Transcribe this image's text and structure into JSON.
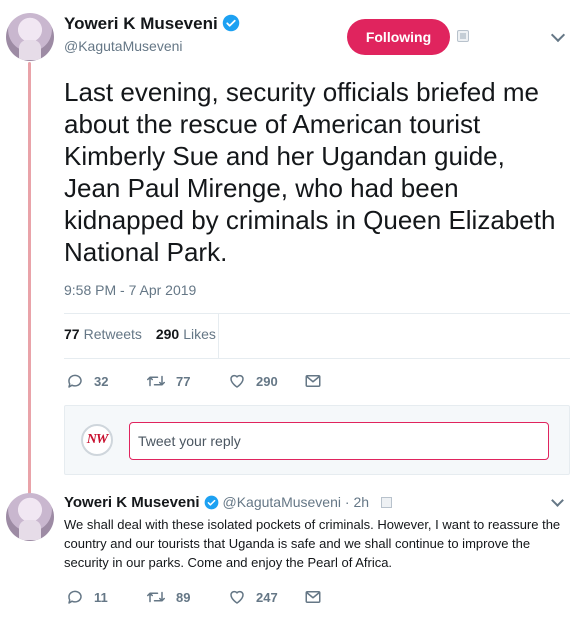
{
  "main_tweet": {
    "author_name": "Yoweri K Museveni",
    "author_handle": "@KagutaMuseveni",
    "follow_button_label": "Following",
    "text": "Last evening, security officials briefed me about the rescue of American tourist Kimberly Sue and her Ugandan guide, Jean Paul Mirenge, who had been kidnapped by criminals in Queen Elizabeth National Park.",
    "timestamp": "9:58 PM - 7 Apr 2019",
    "retweets_count": "77",
    "retweets_label": "Retweets",
    "likes_count": "290",
    "likes_label": "Likes",
    "actions": {
      "reply_count": "32",
      "retweet_count": "77",
      "like_count": "290"
    }
  },
  "reply_composer": {
    "avatar_text": "NW",
    "placeholder": "Tweet your reply"
  },
  "reply_tweet": {
    "author_name": "Yoweri K Museveni",
    "author_handle": "@KagutaMuseveni",
    "time_ago": "· 2h",
    "text": "We shall deal with these isolated pockets of criminals. However, I want to reassure the country and our tourists that Uganda is safe and we shall continue to improve the security in our parks. Come and enjoy the Pearl of Africa.",
    "actions": {
      "reply_count": "11",
      "retweet_count": "89",
      "like_count": "247"
    }
  },
  "colors": {
    "accent": "#e0245e",
    "verified": "#1da1f2",
    "secondary_text": "#657786",
    "thread_line": "#e9a3a9"
  },
  "icons": [
    "verified-badge-icon",
    "block-icon",
    "chevron-down-icon",
    "reply-icon",
    "retweet-icon",
    "like-icon",
    "direct-message-icon"
  ]
}
